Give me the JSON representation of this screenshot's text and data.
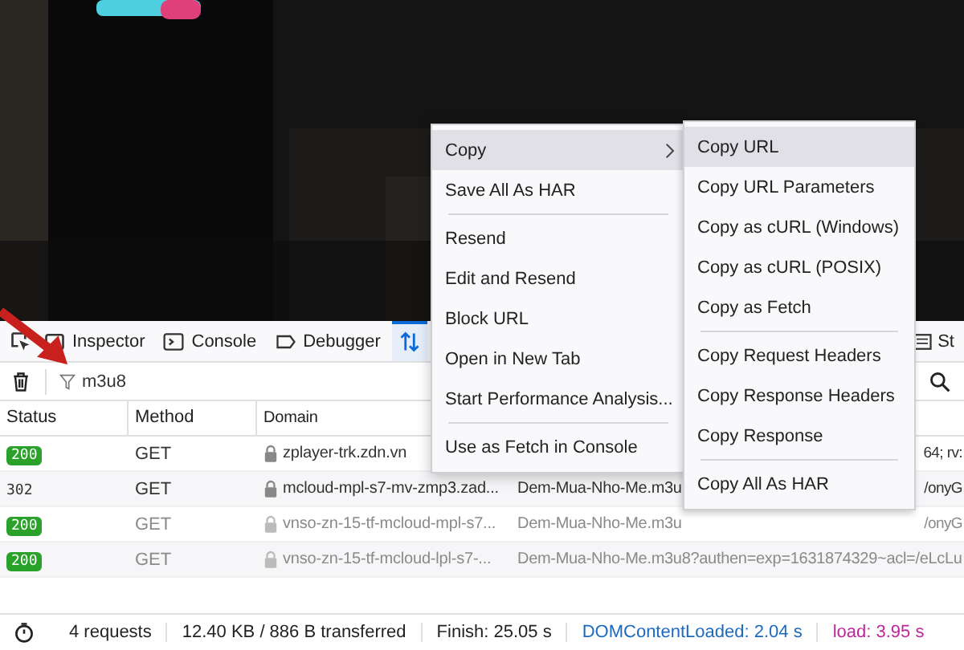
{
  "toolbar": {
    "tabs": [
      {
        "kind": "inspector",
        "label": "Inspector",
        "selected": false
      },
      {
        "kind": "console",
        "label": "Console",
        "selected": false
      },
      {
        "kind": "debugger",
        "label": "Debugger",
        "selected": false
      },
      {
        "kind": "network",
        "selected": true
      }
    ],
    "overflow_tab": "St"
  },
  "filter": {
    "value": "m3u8"
  },
  "table": {
    "columns": [
      "Status",
      "Method",
      "Domain"
    ],
    "rows": [
      {
        "status": "200",
        "method": "GET",
        "domain": "zplayer-trk.zdn.vn",
        "column_4": "",
        "column_5": "64; rv:",
        "dimmed": false
      },
      {
        "status": "302",
        "method": "GET",
        "domain": "mcloud-mpl-s7-mv-zmp3.zad...",
        "column_4": "Dem-Mua-Nho-Me.m3u",
        "column_5": "/onyG",
        "dimmed": false
      },
      {
        "status": "200",
        "method": "GET",
        "domain": "vnso-zn-15-tf-mcloud-mpl-s7...",
        "column_4": "Dem-Mua-Nho-Me.m3u",
        "column_5": "/onyG",
        "dimmed": true
      },
      {
        "status": "200",
        "method": "GET",
        "domain": "vnso-zn-15-tf-mcloud-lpl-s7-...",
        "column_4": "Dem-Mua-Nho-Me.m3u8?authen=exp=1631874329~acl=/eLcLu",
        "column_5": "",
        "dimmed": true
      }
    ]
  },
  "status_bar": {
    "requests": "4 requests",
    "transferred": "12.40 KB / 886 B transferred",
    "finish": "Finish: 25.05 s",
    "dom": "DOMContentLoaded: 2.04 s",
    "load": "load: 3.95 s"
  },
  "context_menu": {
    "items": [
      {
        "kind": "item",
        "label": "Copy",
        "selected": true,
        "submenu": true
      },
      {
        "kind": "item",
        "label": "Save All As HAR",
        "selected": false,
        "submenu": false
      },
      {
        "kind": "separator"
      },
      {
        "kind": "item",
        "label": "Resend",
        "selected": false,
        "submenu": false
      },
      {
        "kind": "item",
        "label": "Edit and Resend",
        "selected": false,
        "submenu": false
      },
      {
        "kind": "item",
        "label": "Block URL",
        "selected": false,
        "submenu": false
      },
      {
        "kind": "item",
        "label": "Open in New Tab",
        "selected": false,
        "submenu": false
      },
      {
        "kind": "item",
        "label": "Start Performance Analysis...",
        "selected": false,
        "submenu": false
      },
      {
        "kind": "separator"
      },
      {
        "kind": "item",
        "label": "Use as Fetch in Console",
        "selected": false,
        "submenu": false
      }
    ]
  },
  "submenu": {
    "items": [
      {
        "kind": "item",
        "label": "Copy URL",
        "selected": true
      },
      {
        "kind": "item",
        "label": "Copy URL Parameters",
        "selected": false
      },
      {
        "kind": "item",
        "label": "Copy as cURL (Windows)",
        "selected": false
      },
      {
        "kind": "item",
        "label": "Copy as cURL (POSIX)",
        "selected": false
      },
      {
        "kind": "item",
        "label": "Copy as Fetch",
        "selected": false
      },
      {
        "kind": "separator"
      },
      {
        "kind": "item",
        "label": "Copy Request Headers",
        "selected": false
      },
      {
        "kind": "item",
        "label": "Copy Response Headers",
        "selected": false
      },
      {
        "kind": "item",
        "label": "Copy Response",
        "selected": false
      },
      {
        "kind": "separator"
      },
      {
        "kind": "item",
        "label": "Copy All As HAR",
        "selected": false
      }
    ]
  }
}
